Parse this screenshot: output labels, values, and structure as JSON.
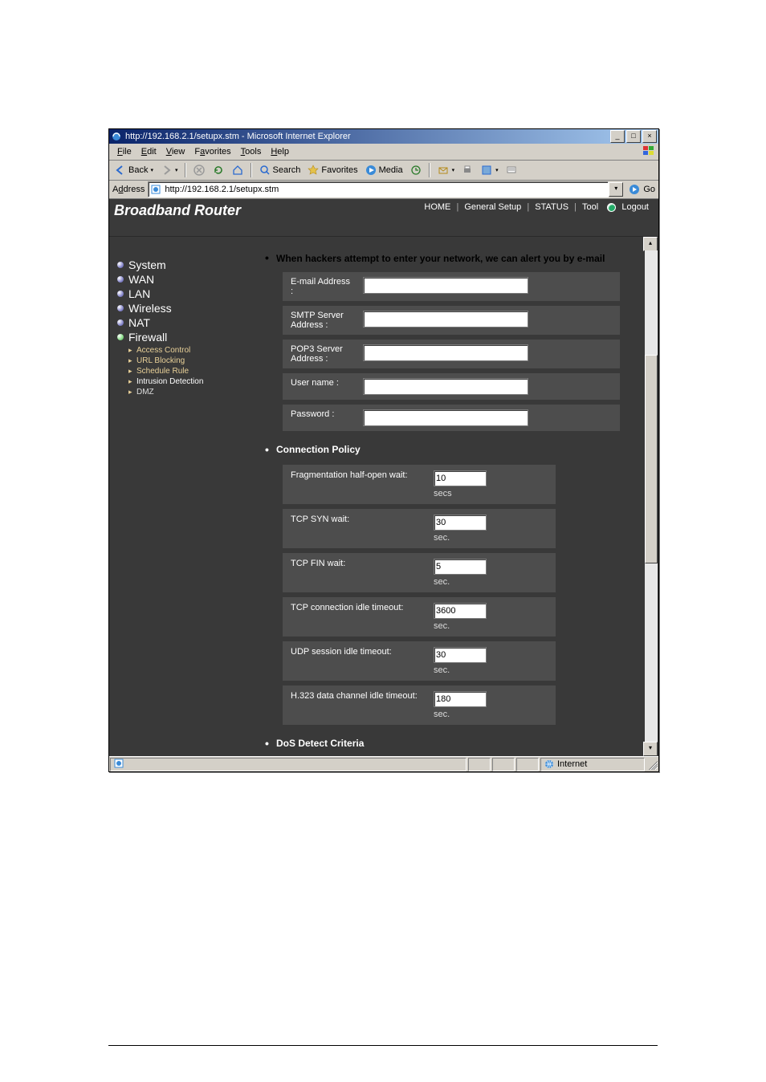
{
  "window": {
    "title": "http://192.168.2.1/setupx.stm - Microsoft Internet Explorer",
    "min": "_",
    "max": "□",
    "close": "×"
  },
  "menu": {
    "file": "File",
    "edit": "Edit",
    "view": "View",
    "favorites": "Favorites",
    "tools": "Tools",
    "help": "Help"
  },
  "toolbar": {
    "back": "Back",
    "search": "Search",
    "favorites": "Favorites",
    "media": "Media"
  },
  "address": {
    "label": "Address",
    "value": "http://192.168.2.1/setupx.stm",
    "go": "Go"
  },
  "router": {
    "brand": "Broadband Router",
    "top_nav": {
      "home": "HOME",
      "general": "General Setup",
      "status": "STATUS",
      "tool": "Tool",
      "logout": "Logout"
    }
  },
  "sidebar": {
    "items": [
      {
        "label": "System"
      },
      {
        "label": "WAN"
      },
      {
        "label": "LAN"
      },
      {
        "label": "Wireless"
      },
      {
        "label": "NAT"
      },
      {
        "label": "Firewall"
      }
    ],
    "firewall_sub": [
      {
        "label": "Access Control"
      },
      {
        "label": "URL Blocking"
      },
      {
        "label": "Schedule Rule"
      },
      {
        "label": "Intrusion Detection"
      },
      {
        "label": "DMZ"
      }
    ]
  },
  "section1": {
    "heading": "When hackers attempt to enter your network, we can alert you by e-mail",
    "fields": {
      "email": {
        "label": "E-mail Address :",
        "value": ""
      },
      "smtp": {
        "label": "SMTP Server Address :",
        "value": ""
      },
      "pop3": {
        "label": "POP3 Server Address :",
        "value": ""
      },
      "user": {
        "label": "User name :",
        "value": ""
      },
      "pass": {
        "label": "Password :",
        "value": ""
      }
    }
  },
  "section2": {
    "heading": "Connection Policy",
    "rows": {
      "frag": {
        "label": "Fragmentation half-open wait:",
        "value": "10",
        "unit": "secs"
      },
      "syn": {
        "label": "TCP SYN wait:",
        "value": "30",
        "unit": "sec."
      },
      "fin": {
        "label": "TCP FIN wait:",
        "value": "5",
        "unit": "sec."
      },
      "tcp_idle": {
        "label": "TCP connection idle timeout:",
        "value": "3600",
        "unit": "sec."
      },
      "udp_idle": {
        "label": "UDP session idle timeout:",
        "value": "30",
        "unit": "sec."
      },
      "h323": {
        "label": "H.323 data channel idle timeout:",
        "value": "180",
        "unit": "sec."
      }
    }
  },
  "section3": {
    "heading": "DoS Detect Criteria"
  },
  "status": {
    "zone": "Internet"
  }
}
